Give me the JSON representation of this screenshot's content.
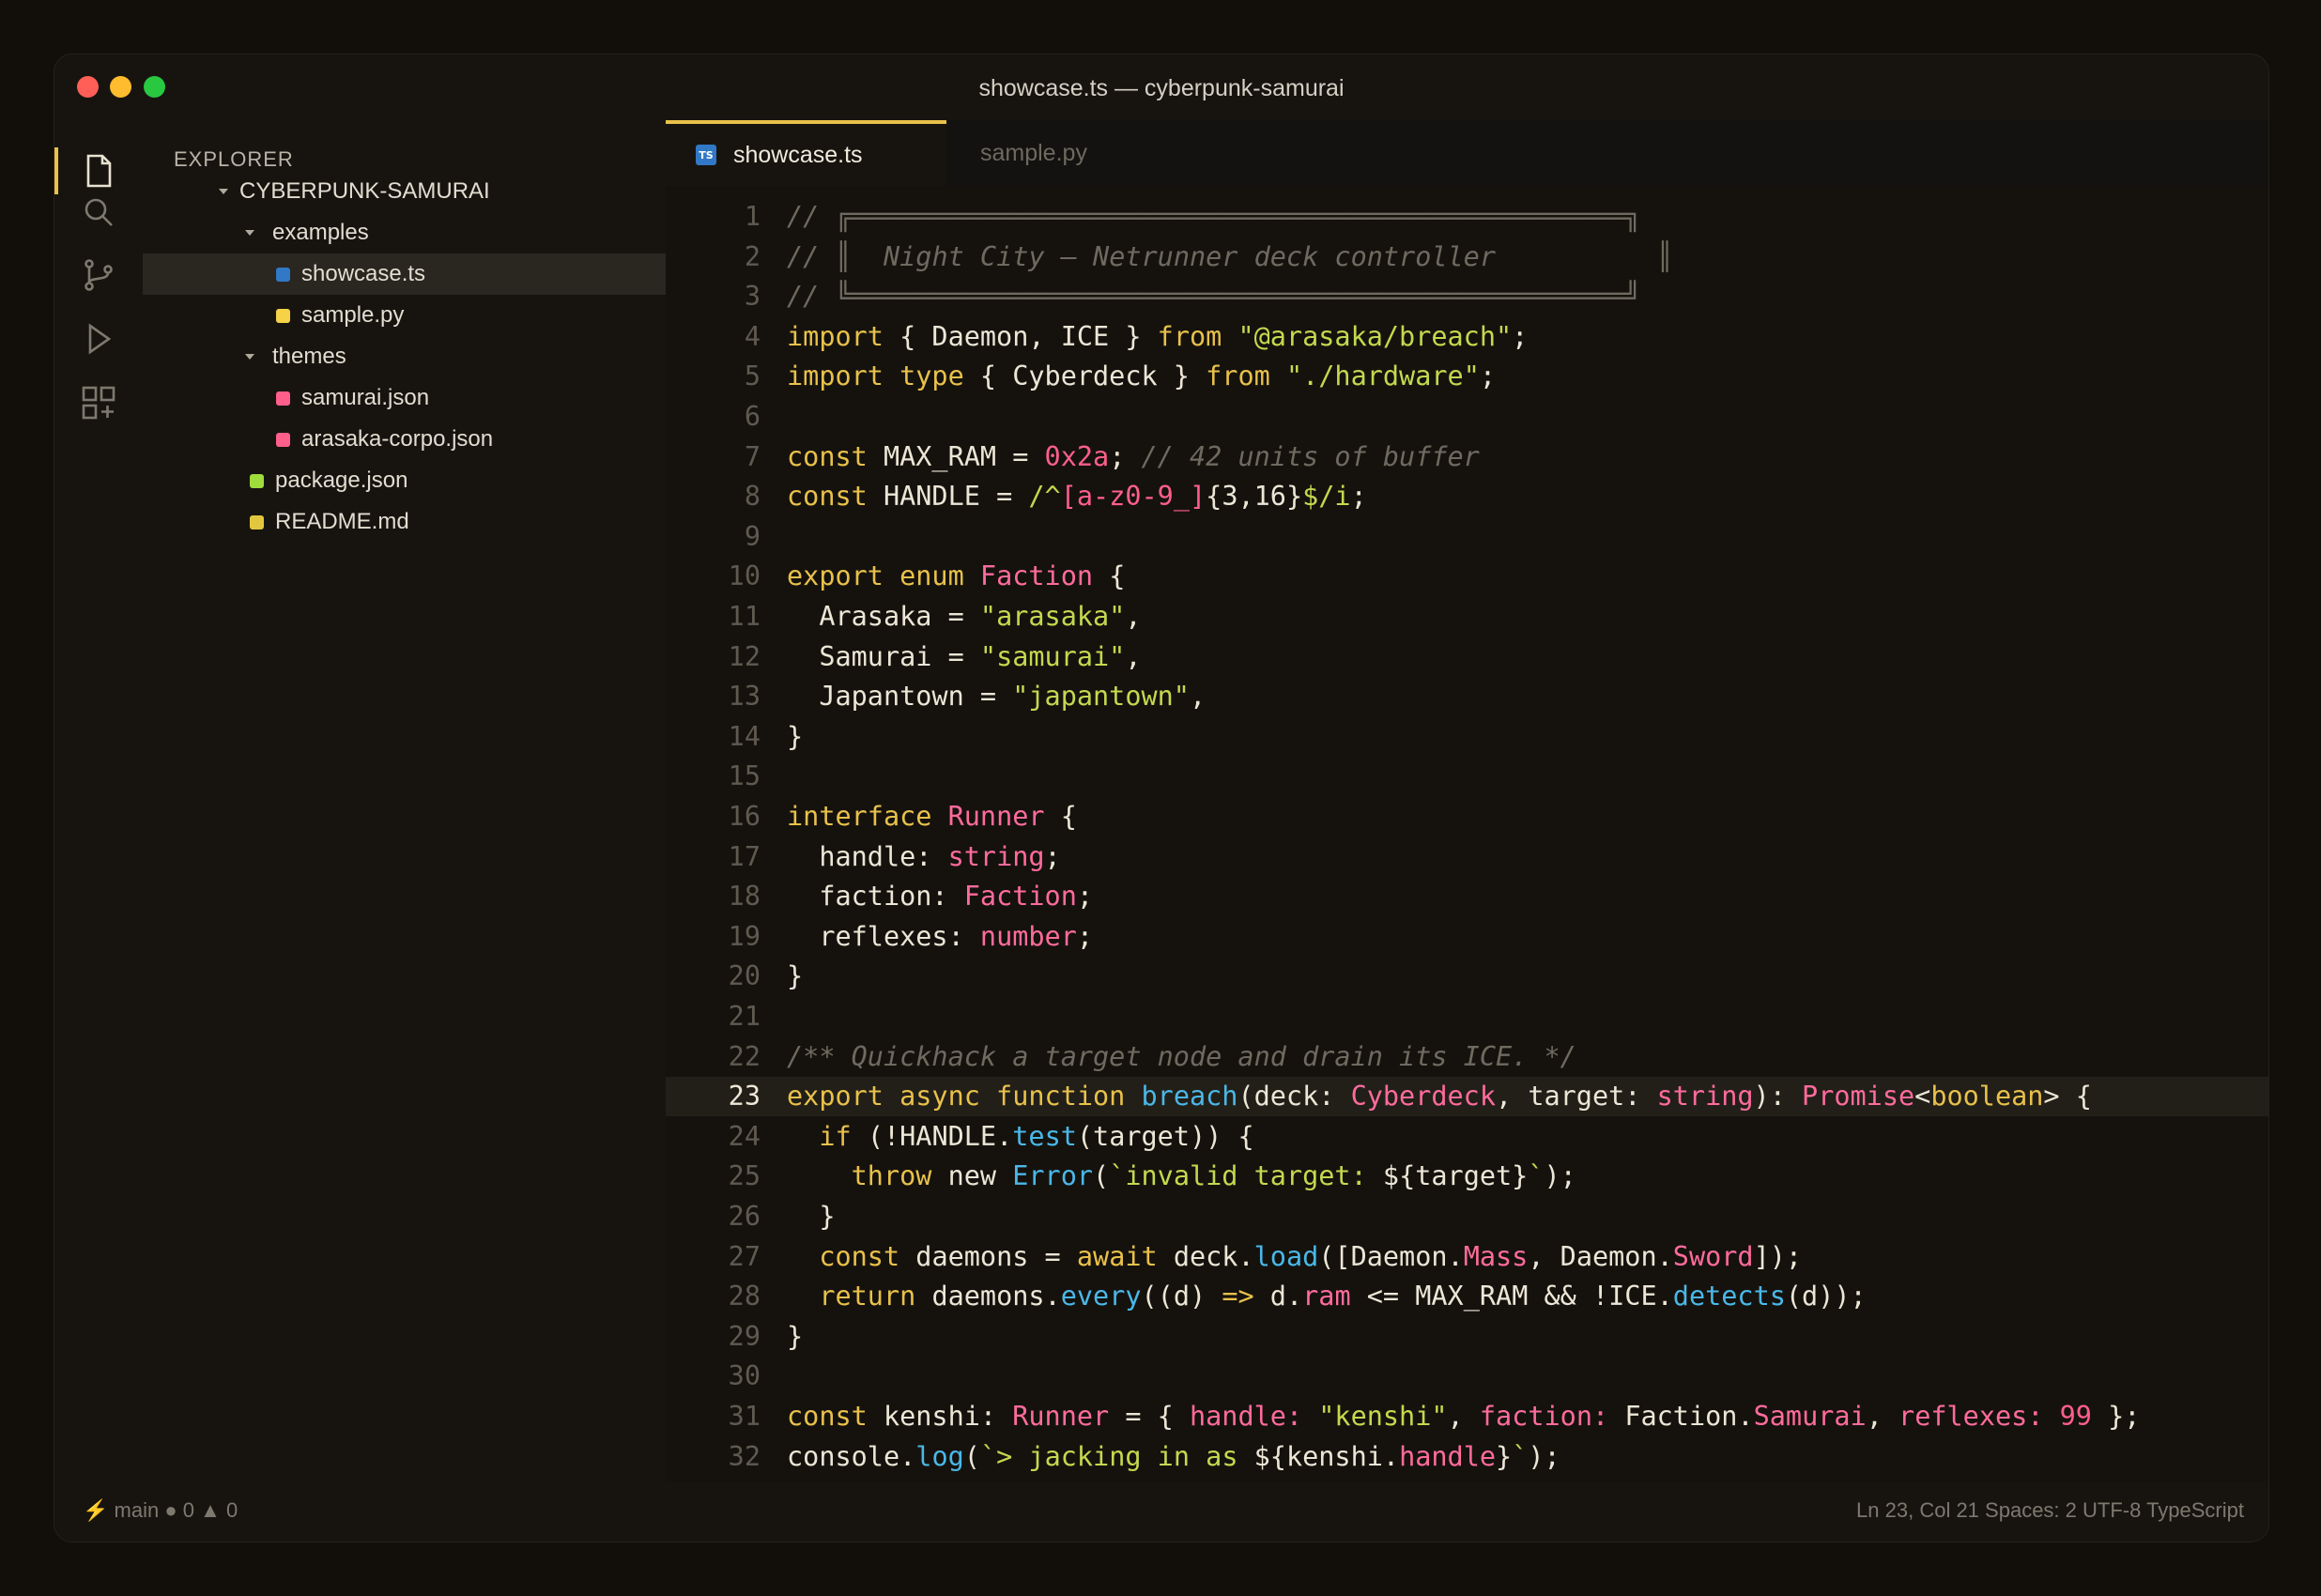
{
  "window": {
    "title": "showcase.ts — cyberpunk-samurai"
  },
  "activity_bar": {
    "items": [
      {
        "icon": "files-icon",
        "active": true
      },
      {
        "icon": "search-icon",
        "active": false
      },
      {
        "icon": "source-control-icon",
        "active": false
      },
      {
        "icon": "run-icon",
        "active": false
      },
      {
        "icon": "extensions-icon",
        "active": false
      }
    ]
  },
  "explorer": {
    "title": "EXPLORER",
    "root": "CYBERPUNK-SAMURAI",
    "folder_examples": "examples",
    "file_showcase": "showcase.ts",
    "file_sample": "sample.py",
    "folder_themes": "themes",
    "file_samurai": "samurai.json",
    "file_arasaka": "arasaka-corpo.json",
    "file_package": "package.json",
    "file_readme": "README.md",
    "colors": {
      "ts": "#3178c6",
      "py": "#f5d247",
      "json_theme": "#ff5f8a",
      "json_pkg": "#9fdc3c",
      "md": "#e2c73e"
    }
  },
  "tabs": {
    "active": {
      "badge": "TS",
      "label": "showcase.ts"
    },
    "inactive": {
      "label": "sample.py"
    }
  },
  "editor": {
    "current_line": 23,
    "lines": [
      {
        "n": "1",
        "tokens": [
          [
            "c-com",
            "//"
          ],
          [
            "c-box",
            " ╔════════════════════════════════════════════════╗"
          ]
        ]
      },
      {
        "n": "2",
        "tokens": [
          [
            "c-com",
            "//"
          ],
          [
            "c-box",
            " ║"
          ],
          [
            "c-com",
            "  Night City — Netrunner deck controller          "
          ],
          [
            "c-box",
            "║"
          ]
        ]
      },
      {
        "n": "3",
        "tokens": [
          [
            "c-com",
            "//"
          ],
          [
            "c-box",
            " ╚════════════════════════════════════════════════╝"
          ]
        ]
      },
      {
        "n": "4",
        "tokens": [
          [
            "c-kw",
            "import"
          ],
          [
            "c-plain",
            " { Daemon, ICE } "
          ],
          [
            "c-kw",
            "from"
          ],
          [
            "c-plain",
            " "
          ],
          [
            "c-str",
            "\"@arasaka/breach\""
          ],
          [
            "c-plain",
            ";"
          ]
        ]
      },
      {
        "n": "5",
        "tokens": [
          [
            "c-kw",
            "import type"
          ],
          [
            "c-plain",
            " { Cyberdeck } "
          ],
          [
            "c-kw",
            "from"
          ],
          [
            "c-plain",
            " "
          ],
          [
            "c-str",
            "\"./hardware\""
          ],
          [
            "c-plain",
            ";"
          ]
        ]
      },
      {
        "n": "6",
        "tokens": []
      },
      {
        "n": "7",
        "tokens": [
          [
            "c-kw",
            "const"
          ],
          [
            "c-plain",
            " MAX_RAM = "
          ],
          [
            "c-num",
            "0x2a"
          ],
          [
            "c-plain",
            "; "
          ],
          [
            "c-com",
            "// 42 units of buffer"
          ]
        ]
      },
      {
        "n": "8",
        "tokens": [
          [
            "c-kw",
            "const"
          ],
          [
            "c-plain",
            " HANDLE = "
          ],
          [
            "c-str",
            "/^"
          ],
          [
            "c-num",
            "[a-z0-9_]"
          ],
          [
            "c-plain",
            "{3,16}"
          ],
          [
            "c-str",
            "$/i"
          ],
          [
            "c-plain",
            ";"
          ]
        ]
      },
      {
        "n": "9",
        "tokens": []
      },
      {
        "n": "10",
        "tokens": [
          [
            "c-kw",
            "export enum"
          ],
          [
            "c-plain",
            " "
          ],
          [
            "c-type",
            "Faction"
          ],
          [
            "c-plain",
            " {"
          ]
        ]
      },
      {
        "n": "11",
        "tokens": [
          [
            "c-plain",
            "  Arasaka = "
          ],
          [
            "c-str",
            "\"arasaka\""
          ],
          [
            "c-plain",
            ","
          ]
        ]
      },
      {
        "n": "12",
        "tokens": [
          [
            "c-plain",
            "  Samurai = "
          ],
          [
            "c-str",
            "\"samurai\""
          ],
          [
            "c-plain",
            ","
          ]
        ]
      },
      {
        "n": "13",
        "tokens": [
          [
            "c-plain",
            "  Japantown = "
          ],
          [
            "c-str",
            "\"japantown\""
          ],
          [
            "c-plain",
            ","
          ]
        ]
      },
      {
        "n": "14",
        "tokens": [
          [
            "c-plain",
            "}"
          ]
        ]
      },
      {
        "n": "15",
        "tokens": []
      },
      {
        "n": "16",
        "tokens": [
          [
            "c-kw",
            "interface"
          ],
          [
            "c-plain",
            " "
          ],
          [
            "c-type",
            "Runner"
          ],
          [
            "c-plain",
            " {"
          ]
        ]
      },
      {
        "n": "17",
        "tokens": [
          [
            "c-plain",
            "  handle: "
          ],
          [
            "c-type",
            "string"
          ],
          [
            "c-plain",
            ";"
          ]
        ]
      },
      {
        "n": "18",
        "tokens": [
          [
            "c-plain",
            "  faction: "
          ],
          [
            "c-type",
            "Faction"
          ],
          [
            "c-plain",
            ";"
          ]
        ]
      },
      {
        "n": "19",
        "tokens": [
          [
            "c-plain",
            "  reflexes: "
          ],
          [
            "c-type",
            "number"
          ],
          [
            "c-plain",
            ";"
          ]
        ]
      },
      {
        "n": "20",
        "tokens": [
          [
            "c-plain",
            "}"
          ]
        ]
      },
      {
        "n": "21",
        "tokens": []
      },
      {
        "n": "22",
        "tokens": [
          [
            "c-com",
            "/** Quickhack a target node and drain its ICE. */"
          ]
        ]
      },
      {
        "n": "23",
        "tokens": [
          [
            "c-kw",
            "export async function"
          ],
          [
            "c-plain",
            " "
          ],
          [
            "c-fn",
            "breach"
          ],
          [
            "c-plain",
            "(deck: "
          ],
          [
            "c-type",
            "Cyberdeck"
          ],
          [
            "c-plain",
            ", target: "
          ],
          [
            "c-type",
            "string"
          ],
          [
            "c-plain",
            "): "
          ],
          [
            "c-type",
            "Promise"
          ],
          [
            "c-plain",
            "<"
          ],
          [
            "c-kw",
            "boolean"
          ],
          [
            "c-plain",
            "> {"
          ]
        ]
      },
      {
        "n": "24",
        "tokens": [
          [
            "c-plain",
            "  "
          ],
          [
            "c-kw",
            "if"
          ],
          [
            "c-plain",
            " (!HANDLE."
          ],
          [
            "c-fn",
            "test"
          ],
          [
            "c-plain",
            "(target)) {"
          ]
        ]
      },
      {
        "n": "25",
        "tokens": [
          [
            "c-plain",
            "    "
          ],
          [
            "c-kw",
            "throw"
          ],
          [
            "c-plain",
            " new "
          ],
          [
            "c-fn",
            "Error"
          ],
          [
            "c-plain",
            "("
          ],
          [
            "c-str",
            "`invalid target: "
          ],
          [
            "c-plain",
            "${target}"
          ],
          [
            "c-str",
            "`"
          ],
          [
            "c-plain",
            ");"
          ]
        ]
      },
      {
        "n": "26",
        "tokens": [
          [
            "c-plain",
            "  }"
          ]
        ]
      },
      {
        "n": "27",
        "tokens": [
          [
            "c-plain",
            "  "
          ],
          [
            "c-kw",
            "const"
          ],
          [
            "c-plain",
            " daemons = "
          ],
          [
            "c-kw",
            "await"
          ],
          [
            "c-plain",
            " deck."
          ],
          [
            "c-fn",
            "load"
          ],
          [
            "c-plain",
            "([Daemon."
          ],
          [
            "c-type",
            "Mass"
          ],
          [
            "c-plain",
            ", Daemon."
          ],
          [
            "c-type",
            "Sword"
          ],
          [
            "c-plain",
            "]);"
          ]
        ]
      },
      {
        "n": "28",
        "tokens": [
          [
            "c-plain",
            "  "
          ],
          [
            "c-kw",
            "return"
          ],
          [
            "c-plain",
            " daemons."
          ],
          [
            "c-fn",
            "every"
          ],
          [
            "c-plain",
            "((d) "
          ],
          [
            "c-kw",
            "=>"
          ],
          [
            "c-plain",
            " d."
          ],
          [
            "c-type",
            "ram"
          ],
          [
            "c-plain",
            " <= MAX_RAM && !ICE."
          ],
          [
            "c-fn",
            "detects"
          ],
          [
            "c-plain",
            "(d));"
          ]
        ]
      },
      {
        "n": "29",
        "tokens": [
          [
            "c-plain",
            "}"
          ]
        ]
      },
      {
        "n": "30",
        "tokens": []
      },
      {
        "n": "31",
        "tokens": [
          [
            "c-kw",
            "const"
          ],
          [
            "c-plain",
            " kenshi: "
          ],
          [
            "c-type",
            "Runner"
          ],
          [
            "c-plain",
            " = { "
          ],
          [
            "c-type",
            "handle:"
          ],
          [
            "c-plain",
            " "
          ],
          [
            "c-str",
            "\"kenshi\""
          ],
          [
            "c-plain",
            ", "
          ],
          [
            "c-type",
            "faction:"
          ],
          [
            "c-plain",
            " Faction."
          ],
          [
            "c-type",
            "Samurai"
          ],
          [
            "c-plain",
            ", "
          ],
          [
            "c-type",
            "reflexes:"
          ],
          [
            "c-plain",
            " "
          ],
          [
            "c-num",
            "99"
          ],
          [
            "c-plain",
            " };"
          ]
        ]
      },
      {
        "n": "32",
        "tokens": [
          [
            "c-plain",
            "console."
          ],
          [
            "c-fn",
            "log"
          ],
          [
            "c-plain",
            "("
          ],
          [
            "c-str",
            "`> jacking in as "
          ],
          [
            "c-plain",
            "${kenshi."
          ],
          [
            "c-type",
            "handle"
          ],
          [
            "c-plain",
            "}"
          ],
          [
            "c-str",
            "`"
          ],
          [
            "c-plain",
            ");"
          ]
        ]
      }
    ]
  },
  "statusbar": {
    "branch_icon": "lightning-icon",
    "branch": "main",
    "errors": "● 0",
    "warnings": "▲ 0",
    "position": "Ln 23, Col 21",
    "spaces": "Spaces: 2",
    "encoding": "UTF-8",
    "language": "TypeScript"
  }
}
